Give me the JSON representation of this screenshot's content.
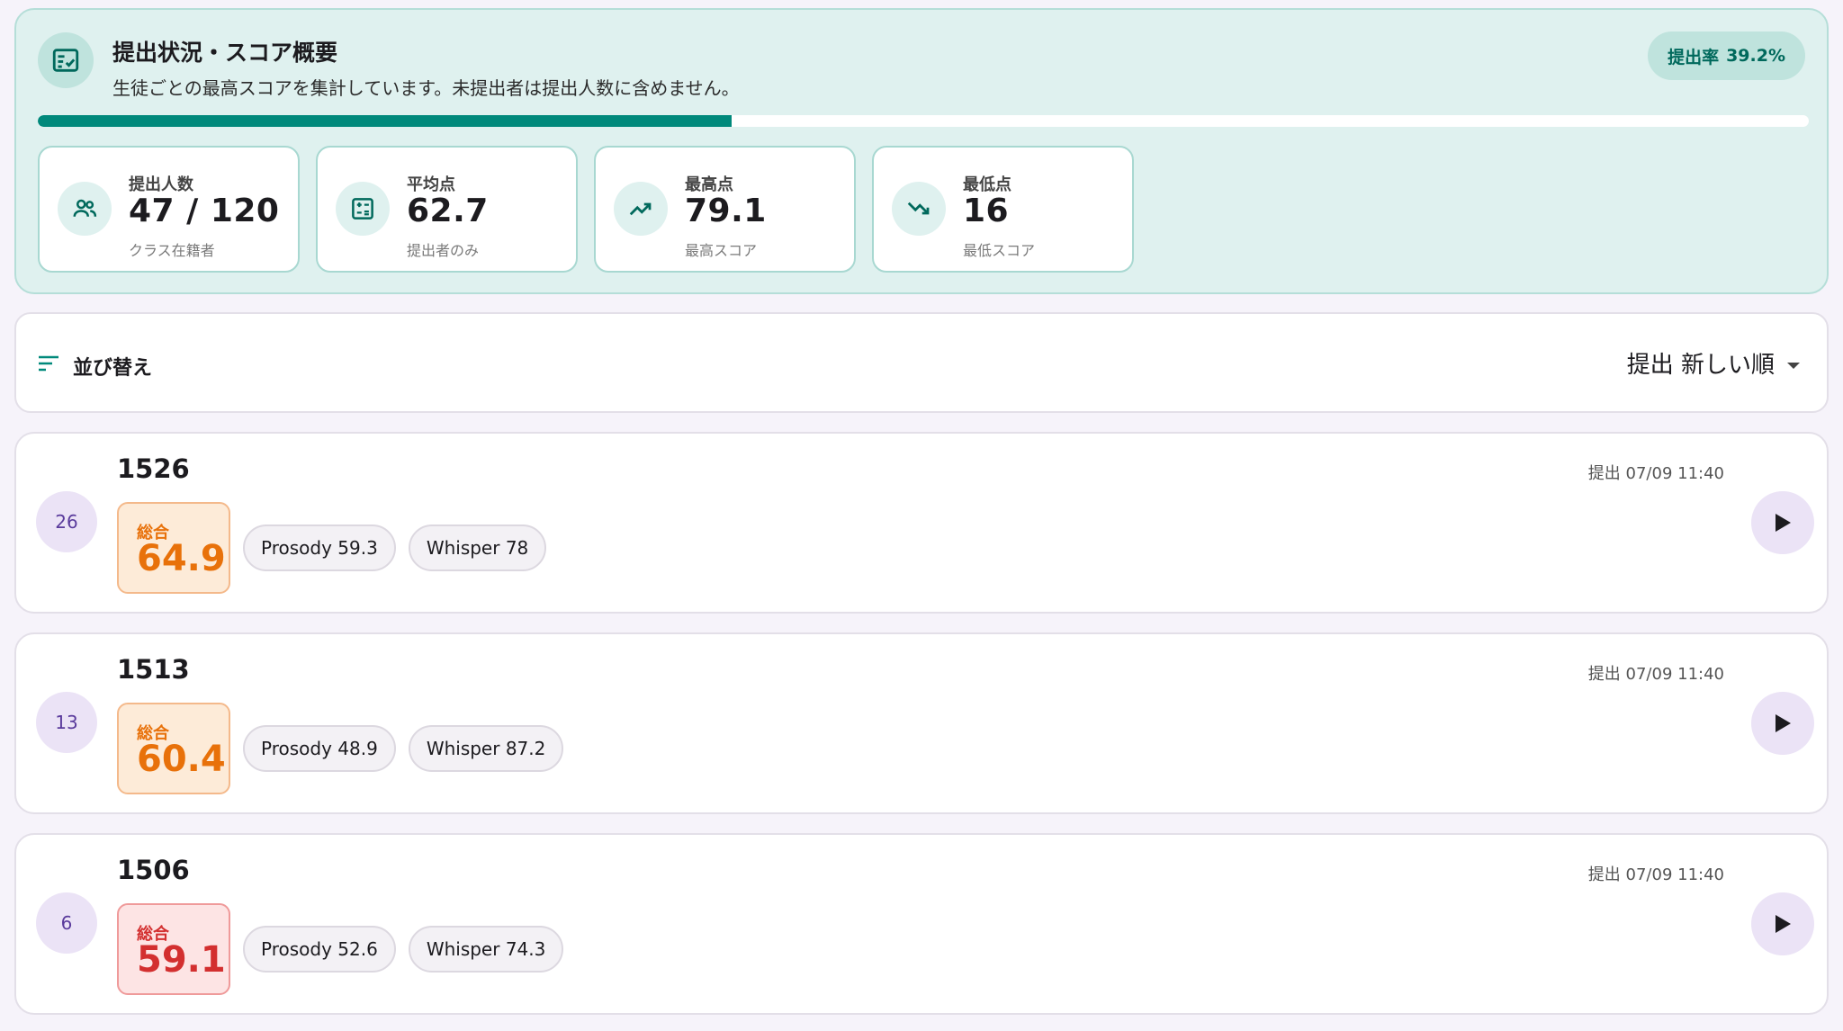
{
  "summary": {
    "title": "提出状況・スコア概要",
    "subtitle": "生徒ごとの最高スコアを集計しています。未提出者は提出人数に含めません。",
    "rate_label": "提出率",
    "rate_value": "39.2%",
    "progress_fraction": 0.392,
    "icon": "fact-check-icon",
    "accent_color": "#00897b",
    "stats": [
      {
        "label": "提出人数",
        "value": "47 / 120",
        "note": "クラス在籍者",
        "icon": "people-icon"
      },
      {
        "label": "平均点",
        "value": "62.7",
        "note": "提出者のみ",
        "icon": "calculator-icon"
      },
      {
        "label": "最高点",
        "value": "79.1",
        "note": "最高スコア",
        "icon": "trending-up-icon"
      },
      {
        "label": "最低点",
        "value": "16",
        "note": "最低スコア",
        "icon": "trending-down-icon"
      }
    ]
  },
  "sort": {
    "label": "並び替え",
    "selected": "提出 新しい順"
  },
  "submissions": [
    {
      "number": "26",
      "id": "1526",
      "time": "提出 07/09 11:40",
      "total_label": "総合",
      "total": "64.9",
      "prosody": "Prosody 59.3",
      "whisper": "Whisper 78",
      "level": "orange"
    },
    {
      "number": "13",
      "id": "1513",
      "time": "提出 07/09 11:40",
      "total_label": "総合",
      "total": "60.4",
      "prosody": "Prosody 48.9",
      "whisper": "Whisper 87.2",
      "level": "orange"
    },
    {
      "number": "6",
      "id": "1506",
      "time": "提出 07/09 11:40",
      "total_label": "総合",
      "total": "59.1",
      "prosody": "Prosody 52.6",
      "whisper": "Whisper 74.3",
      "level": "red"
    }
  ]
}
